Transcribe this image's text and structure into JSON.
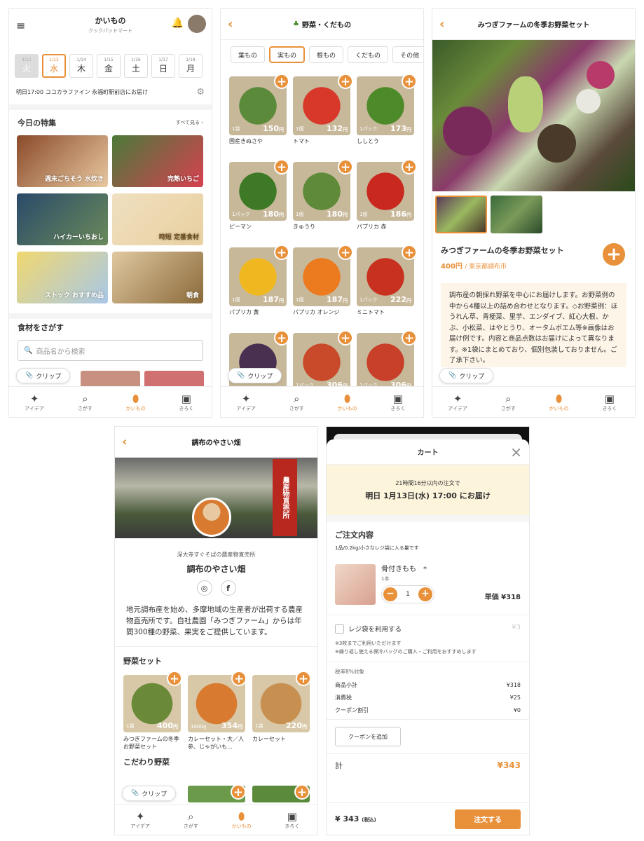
{
  "s1": {
    "title": "かいもの",
    "subtitle": "クックパッドマート",
    "dates": [
      {
        "md": "1/12",
        "day": "火"
      },
      {
        "md": "1/13",
        "day": "水"
      },
      {
        "md": "1/14",
        "day": "木"
      },
      {
        "md": "1/15",
        "day": "金"
      },
      {
        "md": "1/16",
        "day": "土"
      },
      {
        "md": "1/17",
        "day": "日"
      },
      {
        "md": "1/18",
        "day": "月"
      }
    ],
    "delivery": "明日17:00 ココカラファイン 永福町駅前店にお届け",
    "feature_title": "今日の特集",
    "see_all": "すべて見る",
    "banners": [
      "週末ごちそう 水炊き",
      "完熟いちご",
      "ハイカーいちおし",
      "時短 定番食材",
      "ストック おすすめ品",
      "朝食"
    ],
    "search_title": "食材をさがす",
    "search_placeholder": "商品名から検索",
    "clip": "クリップ"
  },
  "tabs": [
    "アイデア",
    "さがす",
    "かいもの",
    "きろく"
  ],
  "s2": {
    "title": "野菜・くだもの",
    "cats": [
      "葉もの",
      "実もの",
      "根もの",
      "くだもの",
      "その他"
    ],
    "items": [
      {
        "q": "1袋",
        "p": "150",
        "n": "国産きぬさや",
        "c": "#5a8a3a"
      },
      {
        "q": "1個",
        "p": "132",
        "n": "トマト",
        "c": "#d8382a"
      },
      {
        "q": "1パック",
        "p": "173",
        "n": "ししとう",
        "c": "#4d8a2a"
      },
      {
        "q": "1パック",
        "p": "180",
        "n": "ピーマン",
        "c": "#3e7a26"
      },
      {
        "q": "1個",
        "p": "180",
        "n": "きゅうり",
        "c": "#5e8a3a"
      },
      {
        "q": "1個",
        "p": "186",
        "n": "パプリカ 赤",
        "c": "#c8281e"
      },
      {
        "q": "1個",
        "p": "187",
        "n": "パプリカ 黄",
        "c": "#f0b820"
      },
      {
        "q": "1個",
        "p": "187",
        "n": "パプリカ オレンジ",
        "c": "#ec7a1e"
      },
      {
        "q": "1パック",
        "p": "222",
        "n": "ミニトマト",
        "c": "#c83020"
      },
      {
        "q": "",
        "p": "",
        "n": "",
        "c": "#4a3050"
      },
      {
        "q": "1パック",
        "p": "306",
        "n": "",
        "c": "#c84a2a"
      },
      {
        "q": "1パック",
        "p": "306",
        "n": "",
        "c": "#c8402a"
      }
    ],
    "yen": "円",
    "clip": "クリップ"
  },
  "s3": {
    "title": "みつぎファームの冬季お野菜セット",
    "name": "みつぎファームの冬季お野菜セット",
    "price": "400円",
    "origin": "東京都調布市",
    "desc": "調布産の朝採れ野菜を中心にお届けします。お野菜例の中から4種以上の詰め合わせとなります。◇お野菜例：ほうれん草、青梗菜、里芋、エンダイブ、紅心大根、かぶ、小松菜、はやとうり、オータムポエム等※画像はお届け例です。内容と商品点数はお届けによって異なります。※1袋にまとめており、個別包装しておりません。ご了承下さい。",
    "clip": "クリップ"
  },
  "s4": {
    "title": "調布のやさい畑",
    "sub": "深大寺すぐそばの農産物直売所",
    "name": "調布のやさい畑",
    "sign": "農産物直売所",
    "desc": "地元調布産を始め、多摩地域の生産者が出荷する農産物直売所です。自社農園「みつぎファーム」からは年間300種の野菜、果実をご提供しています。",
    "set_title": "野菜セット",
    "sets": [
      {
        "q": "1袋",
        "p": "400",
        "n": "みつぎファームの冬季お野菜セット",
        "c": "#6a8a3a"
      },
      {
        "q": "1000g",
        "p": "354",
        "n": "カレーセット・大／人参、じゃがいも…",
        "c": "#d87a30"
      },
      {
        "q": "1袋",
        "p": "220",
        "n": "カレーセット",
        "c": "#c89050"
      }
    ],
    "kodawari": "こだわり野菜",
    "clip": "クリップ",
    "yen": "円"
  },
  "s5": {
    "title": "カート",
    "deadline": "21時間16分以内の注文で",
    "delivery": "明日 1月13日(水) 17:00 にお届け",
    "order_title": "ご注文内容",
    "order_note": "1品/0.2kg/小さなレジ袋に入る量です",
    "item_name": "骨付きもも　*",
    "item_unit": "1本",
    "qty": "1",
    "unit_price": "単価 ¥318",
    "bag_label": "レジ袋を利用する",
    "bag_price": "¥3",
    "bag_note": "※3枚までご利用いただけます\n※繰り返し使える保冷バッグのご購入・ご利用をおすすめします",
    "tax_label": "税率8%対象",
    "rows": [
      {
        "k": "商品小計",
        "v": "¥318"
      },
      {
        "k": "消費税",
        "v": "¥25"
      },
      {
        "k": "クーポン割引",
        "v": "¥0"
      }
    ],
    "coupon_btn": "クーポンを追加",
    "total_label": "計",
    "total": "¥343",
    "footer_total": "¥ 343",
    "footer_tax": "(税込)",
    "order_btn": "注文する"
  }
}
